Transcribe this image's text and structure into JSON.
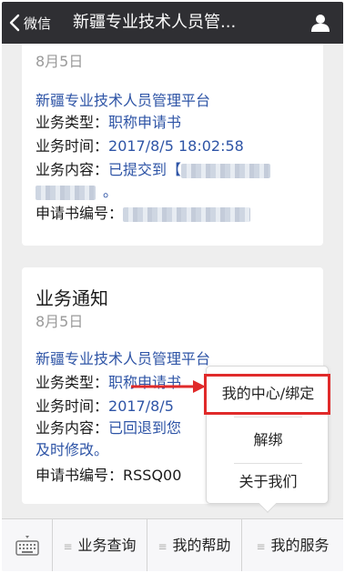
{
  "navbar": {
    "back_label": "微信",
    "title": "新疆专业技术人员管..."
  },
  "card1": {
    "date": "8月5日",
    "platform": "新疆专业技术人员管理平台",
    "type_label": "业务类型：",
    "type_value": "职称申请书",
    "time_label": "业务时间：",
    "time_value": "2017/8/5 18:02:58",
    "content_label": "业务内容：",
    "content_value": "已提交到【",
    "content_end": "。",
    "number_label": "申请书编号："
  },
  "card2": {
    "title": "业务通知",
    "date": "8月5日",
    "platform": "新疆专业技术人员管理平台",
    "type_label": "业务类型：",
    "type_value": "职称申请书",
    "time_label": "业务时间：",
    "time_value": "2017/8/5",
    "content_label": "业务内容：",
    "content_value": "已回退到您",
    "content_line2": "及时修改。",
    "number_label": "申请书编号：",
    "number_value": "RSSQ00"
  },
  "popup": {
    "items": [
      "我的中心/绑定",
      "解绑",
      "关于我们"
    ]
  },
  "bottom_menu": {
    "items": [
      "业务查询",
      "我的帮助",
      "我的服务"
    ]
  },
  "colors": {
    "navbar": "#2f2f33",
    "link": "#2e54a6",
    "highlight": "#e02a2a"
  }
}
